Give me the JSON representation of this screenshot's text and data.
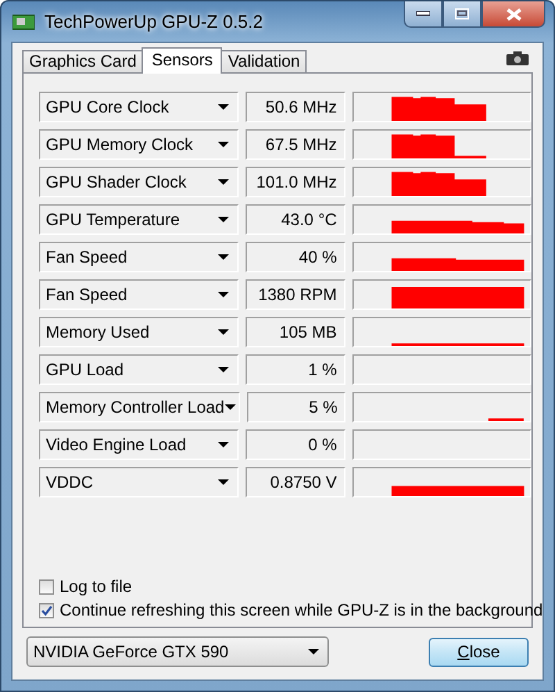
{
  "window": {
    "title": "TechPowerUp GPU-Z 0.5.2"
  },
  "tabs": [
    {
      "label": "Graphics Card",
      "selected": false
    },
    {
      "label": "Sensors",
      "selected": true
    },
    {
      "label": "Validation",
      "selected": false
    }
  ],
  "sensors": [
    {
      "name": "GPU Core Clock",
      "value": "50.6 MHz"
    },
    {
      "name": "GPU Memory Clock",
      "value": "67.5 MHz"
    },
    {
      "name": "GPU Shader Clock",
      "value": "101.0 MHz"
    },
    {
      "name": "GPU Temperature",
      "value": "43.0 °C"
    },
    {
      "name": "Fan Speed",
      "value": "40 %"
    },
    {
      "name": "Fan Speed",
      "value": "1380 RPM"
    },
    {
      "name": "Memory Used",
      "value": "105 MB"
    },
    {
      "name": "GPU Load",
      "value": "1 %"
    },
    {
      "name": "Memory Controller Load",
      "value": "5 %"
    },
    {
      "name": "Video Engine Load",
      "value": "0 %"
    },
    {
      "name": "VDDC",
      "value": "0.8750 V"
    }
  ],
  "options": [
    {
      "label": "Log to file",
      "checked": false
    },
    {
      "label": "Continue refreshing this screen while GPU-Z is in the background",
      "checked": true
    }
  ],
  "gpu_select": {
    "value": "NVIDIA GeForce GTX 590"
  },
  "buttons": [
    {
      "label": "Close"
    }
  ]
}
